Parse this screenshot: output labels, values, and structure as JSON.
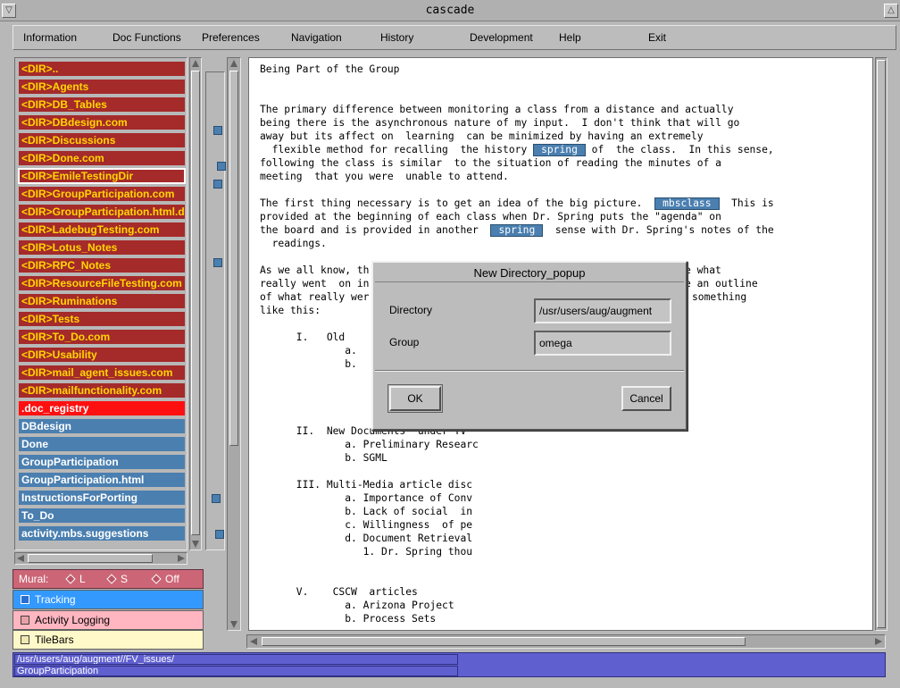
{
  "window": {
    "title": "cascade"
  },
  "menu": [
    {
      "label": "Information"
    },
    {
      "label": "Doc Functions"
    },
    {
      "label": "Preferences"
    },
    {
      "label": "Navigation"
    },
    {
      "label": "History"
    },
    {
      "label": "Development"
    },
    {
      "label": "Help"
    },
    {
      "label": "Exit"
    }
  ],
  "files": [
    {
      "label": "<DIR>..",
      "kind": "dir"
    },
    {
      "label": "<DIR>Agents",
      "kind": "dir"
    },
    {
      "label": "<DIR>DB_Tables",
      "kind": "dir"
    },
    {
      "label": "<DIR>DBdesign.com",
      "kind": "dir"
    },
    {
      "label": "<DIR>Discussions",
      "kind": "dir"
    },
    {
      "label": "<DIR>Done.com",
      "kind": "dir"
    },
    {
      "label": "<DIR>EmileTestingDir",
      "kind": "dir",
      "selected": true
    },
    {
      "label": "<DIR>GroupParticipation.com",
      "kind": "dir"
    },
    {
      "label": "<DIR>GroupParticipation.html.d",
      "kind": "dir"
    },
    {
      "label": "<DIR>LadebugTesting.com",
      "kind": "dir"
    },
    {
      "label": "<DIR>Lotus_Notes",
      "kind": "dir"
    },
    {
      "label": "<DIR>RPC_Notes",
      "kind": "dir"
    },
    {
      "label": "<DIR>ResourceFileTesting.com",
      "kind": "dir"
    },
    {
      "label": "<DIR>Ruminations",
      "kind": "dir"
    },
    {
      "label": "<DIR>Tests",
      "kind": "dir"
    },
    {
      "label": "<DIR>To_Do.com",
      "kind": "dir"
    },
    {
      "label": "<DIR>Usability",
      "kind": "dir"
    },
    {
      "label": "<DIR>mail_agent_issues.com",
      "kind": "dir"
    },
    {
      "label": "<DIR>mailfunctionality.com",
      "kind": "dir"
    },
    {
      "label": ".doc_registry",
      "kind": "red"
    },
    {
      "label": "DBdesign",
      "kind": "blue"
    },
    {
      "label": "Done",
      "kind": "blue"
    },
    {
      "label": "GroupParticipation",
      "kind": "blue"
    },
    {
      "label": "GroupParticipation.html",
      "kind": "blue"
    },
    {
      "label": "InstructionsForPorting",
      "kind": "blue"
    },
    {
      "label": "To_Do",
      "kind": "blue"
    },
    {
      "label": "activity.mbs.suggestions",
      "kind": "blue"
    }
  ],
  "document": {
    "title": "Being Part of the Group",
    "p1": [
      "The primary difference between monitoring a class from a distance and actually",
      "being there is the asynchronous nature of my input.  I don't think that will go",
      "away but its affect on  learning  can be minimized by having an extremely",
      "  flexible method for recalling  the history ",
      " of  the class.  In this sense,",
      "following the class is similar  to the situation of reading the minutes of a",
      "meeting  that you were  unable to attend."
    ],
    "link_spring": "spring",
    "link_mbsclass": "mbsclass",
    "p2": [
      "The first thing necessary is to get an idea of the big picture.  ",
      "  This is",
      "provided at the beginning of each class when Dr. Spring puts the \"agenda\" on",
      "the board and is provided in another  ",
      "  sense with Dr. Spring's notes of the",
      "  readings."
    ],
    "p3a": [
      "As we all know, th",
      "really went  on in",
      "of what really wer",
      "like this:"
    ],
    "p3b": [
      "e what",
      "e an outline",
      "something"
    ],
    "outline": [
      "      I.   Old",
      "              a.",
      "              b.",
      "      II.  New Documents  under TV",
      "              a. Preliminary Researc",
      "              b. SGML",
      "      III. Multi-Media article disc",
      "              a. Importance of Conv",
      "              b. Lack of social  in",
      "              c. Willingness  of pe",
      "              d. Document Retrieval",
      "                 1. Dr. Spring thou",
      "      V.    CSCW  articles",
      "              a. Arizona Project",
      "              b. Process Sets"
    ]
  },
  "mural": {
    "label": "Mural:",
    "opt_l": "L",
    "opt_s": "S",
    "opt_off": "Off"
  },
  "toggles": {
    "tracking": "Tracking",
    "activity_logging": "Activity Logging",
    "tilebars": "TileBars"
  },
  "status": {
    "path": "/usr/users/aug/augment//FV_issues/",
    "file": "GroupParticipation"
  },
  "dialog": {
    "title": "New Directory_popup",
    "directory_label": "Directory",
    "directory_value": "/usr/users/aug/augment",
    "group_label": "Group",
    "group_value": "omega",
    "ok_label": "OK",
    "cancel_label": "Cancel"
  },
  "colors": {
    "dir_bg": "#a52a2a",
    "dir_fg": "#ffd700",
    "file_bg": "#4a7fb0",
    "registry_bg": "#ff1010",
    "status_bg": "#5f5fcf",
    "mural_bg": "#cc6677"
  }
}
